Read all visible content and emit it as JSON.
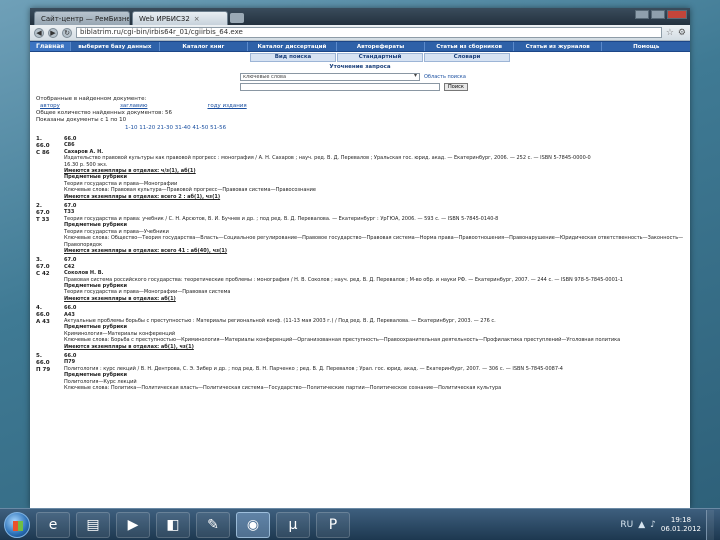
{
  "browser": {
    "tabs": [
      {
        "label": "Сайт-центр — РемБизнес",
        "close": "×"
      },
      {
        "label": "Web ИРБИС32",
        "close": "×"
      }
    ],
    "url": "biblatrim.ru/cgi-bin/irbis64r_01/cgiirbis_64.exe",
    "back": "◀",
    "forward": "▶",
    "reload": "↻"
  },
  "nav": {
    "home": "Главная",
    "items": [
      "выберите базу данных",
      "Каталог книг",
      "Каталог диссертаций",
      "Авторефераты",
      "Статьи из сборников",
      "Статьи из журналов",
      "Помощь"
    ]
  },
  "subnav": {
    "items": [
      "Вид поиска",
      "Стандартный",
      "Словари"
    ]
  },
  "search": {
    "title": "Уточнение запроса",
    "field_value": "ключевые слова",
    "scope_link": "Область поиска",
    "button": "Поиск"
  },
  "results": {
    "caption": "Отобранные в найденном документе:",
    "sort_labels": [
      "автору",
      "заглавию",
      "году издания"
    ],
    "found": "Общее количество найденных документов: 56",
    "shown": "Показаны документы с 1 по 10",
    "pager": "1-10 11-20 21-30 31-40 41-50 51-56",
    "records": [
      {
        "code": "1.\n66.0\nС 86",
        "body": [
          {
            "t": "66.0\nС86",
            "c": "b"
          },
          {
            "t": "Сахаров А. Н.",
            "c": "b"
          },
          {
            "t": "Издательство правовой культуры как правовой прогресс : монография / А. Н. Сахаров ; науч. ред. В. Д. Перевалов ; Уральская гос. юрид. акад. — Екатеринбург, 2006. — 252 с. — ISBN 5-7845-0000-0"
          },
          {
            "t": "16.30 р. 500 экз."
          },
          {
            "t": "Имеются экземпляры в отделах: ч/з(1), аб(1)",
            "c": "ul"
          },
          {
            "t": "Предметные рубрики",
            "c": "b"
          },
          {
            "t": "Теория государства и права—Монографии"
          },
          {
            "t": "Ключевые слова: Правовая культура—Правовой прогресс—Правовая система—Правосознание"
          },
          {
            "t": "Имеются экземпляры в отделах: всего 2 : аб(1), чз(1)",
            "c": "ul"
          }
        ]
      },
      {
        "code": "2.\n67.0\nТ 33",
        "body": [
          {
            "t": "67.0\nТ33",
            "c": "b"
          },
          {
            "t": "Теория государства и права: учебник / С. Н. Арсютов, В. И. Бучнев и др. ; под ред. В. Д. Перевалова. — Екатеринбург : УрГЮА, 2006. — 593 с. — ISBN 5-7845-0140-8"
          },
          {
            "t": "Предметные рубрики",
            "c": "b"
          },
          {
            "t": "Теория государства и права—Учебники"
          },
          {
            "t": "Ключевые слова: Общество—Теория государства—Власть—Социальное регулирование—Правовое государство—Правовая система—Норма права—Правоотношения—Правонарушение—Юридическая ответственность—Законность—Правопорядок"
          },
          {
            "t": "Имеются экземпляры в отделах: всего 41 : аб(40), чз(1)",
            "c": "ul"
          }
        ]
      },
      {
        "code": "3.\n67.0\nС 42",
        "body": [
          {
            "t": "67.0\nС42",
            "c": "b"
          },
          {
            "t": "Соколов Н. В.",
            "c": "b"
          },
          {
            "t": "Правовая система российского государства: теоретические проблемы : монография / Н. В. Соколов ; науч. ред. В. Д. Перевалов ; М-во обр. и науки РФ. — Екатеринбург, 2007. — 244 с. — ISBN 978-5-7845-0001-1"
          },
          {
            "t": "Предметные рубрики",
            "c": "b"
          },
          {
            "t": "Теория государства и права—Монографии—Правовая система"
          },
          {
            "t": "Имеются экземпляры в отделах: аб(1)",
            "c": "ul"
          }
        ]
      },
      {
        "code": "4.\n66.0\nА 43",
        "body": [
          {
            "t": "66.0\nА43",
            "c": "b"
          },
          {
            "t": "Актуальные проблемы борьбы с преступностью : Материалы региональной конф. (11-13 мая 2003 г.) / Под ред. В. Д. Перевалова. — Екатеринбург, 2003. — 276 с."
          },
          {
            "t": "Предметные рубрики",
            "c": "b"
          },
          {
            "t": "Криминология—Материалы конференций"
          },
          {
            "t": "Ключевые слова: Борьба с преступностью—Криминология—Материалы конференций—Организованная преступность—Правоохранительная деятельность—Профилактика преступлений—Уголовная политика"
          },
          {
            "t": "Имеются экземпляры в отделах: аб(1), чз(1)",
            "c": "ul"
          }
        ]
      },
      {
        "code": "5.\n66.0\nП 79",
        "body": [
          {
            "t": "66.0\nП79",
            "c": "b"
          },
          {
            "t": "Политология : курс лекций / В. Н. Дентрова, С. Э. Зибер и др. ; под ред. В. Н. Парченко ; ред. В. Д. Перевалов ; Урал. гос. юрид. акад. — Екатеринбург, 2007. — 306 с. — ISBN 5-7845-0087-4"
          },
          {
            "t": "Предметные рубрики",
            "c": "b"
          },
          {
            "t": "Политология—Курс лекций"
          },
          {
            "t": "Ключевые слова: Политика—Политическая власть—Политическая система—Государство—Политические партии—Политическое сознание—Политическая культура"
          }
        ]
      }
    ]
  },
  "taskbar": {
    "items": [
      "ie-icon",
      "explorer-icon",
      "media-icon",
      "irbis-icon",
      "paint-icon",
      "chrome-icon",
      "utorrent-icon",
      "powerpoint-icon"
    ],
    "time": "19:18",
    "date": "06.01.2012",
    "lang": "RU"
  }
}
